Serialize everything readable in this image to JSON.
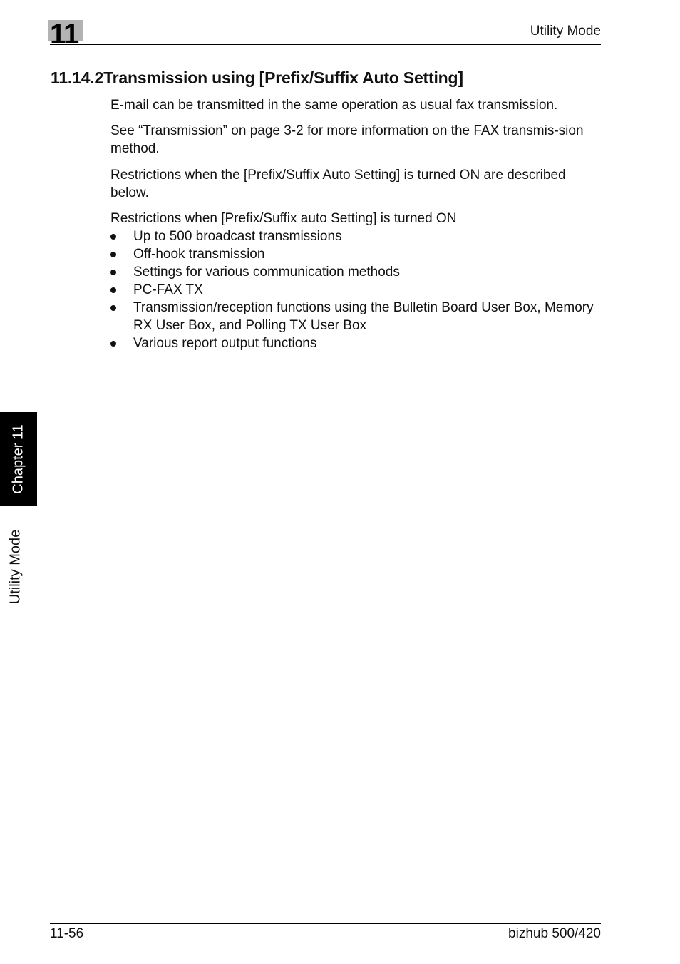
{
  "header": {
    "chapter_number": "11",
    "title": "Utility Mode"
  },
  "section": {
    "title": "11.14.2Transmission using [Prefix/Suffix Auto Setting]"
  },
  "paragraphs": [
    "E-mail can be transmitted in the same operation as usual fax transmission.",
    "See “Transmission” on page 3-2 for more information on the FAX transmis-sion method.",
    "Restrictions when the [Prefix/Suffix Auto Setting] is turned ON are described below.",
    "Restrictions when [Prefix/Suffix auto Setting] is turned ON"
  ],
  "bullets": [
    "Up to 500 broadcast transmissions",
    "Off-hook transmission",
    "Settings for various communication methods",
    "PC-FAX TX",
    "Transmission/reception functions using the Bulletin Board User Box, Memory RX User Box, and Polling TX User Box",
    "Various report output functions"
  ],
  "side_tabs": {
    "chapter": "Chapter 11",
    "section": "Utility Mode"
  },
  "footer": {
    "page_number": "11-56",
    "product": "bizhub 500/420"
  }
}
